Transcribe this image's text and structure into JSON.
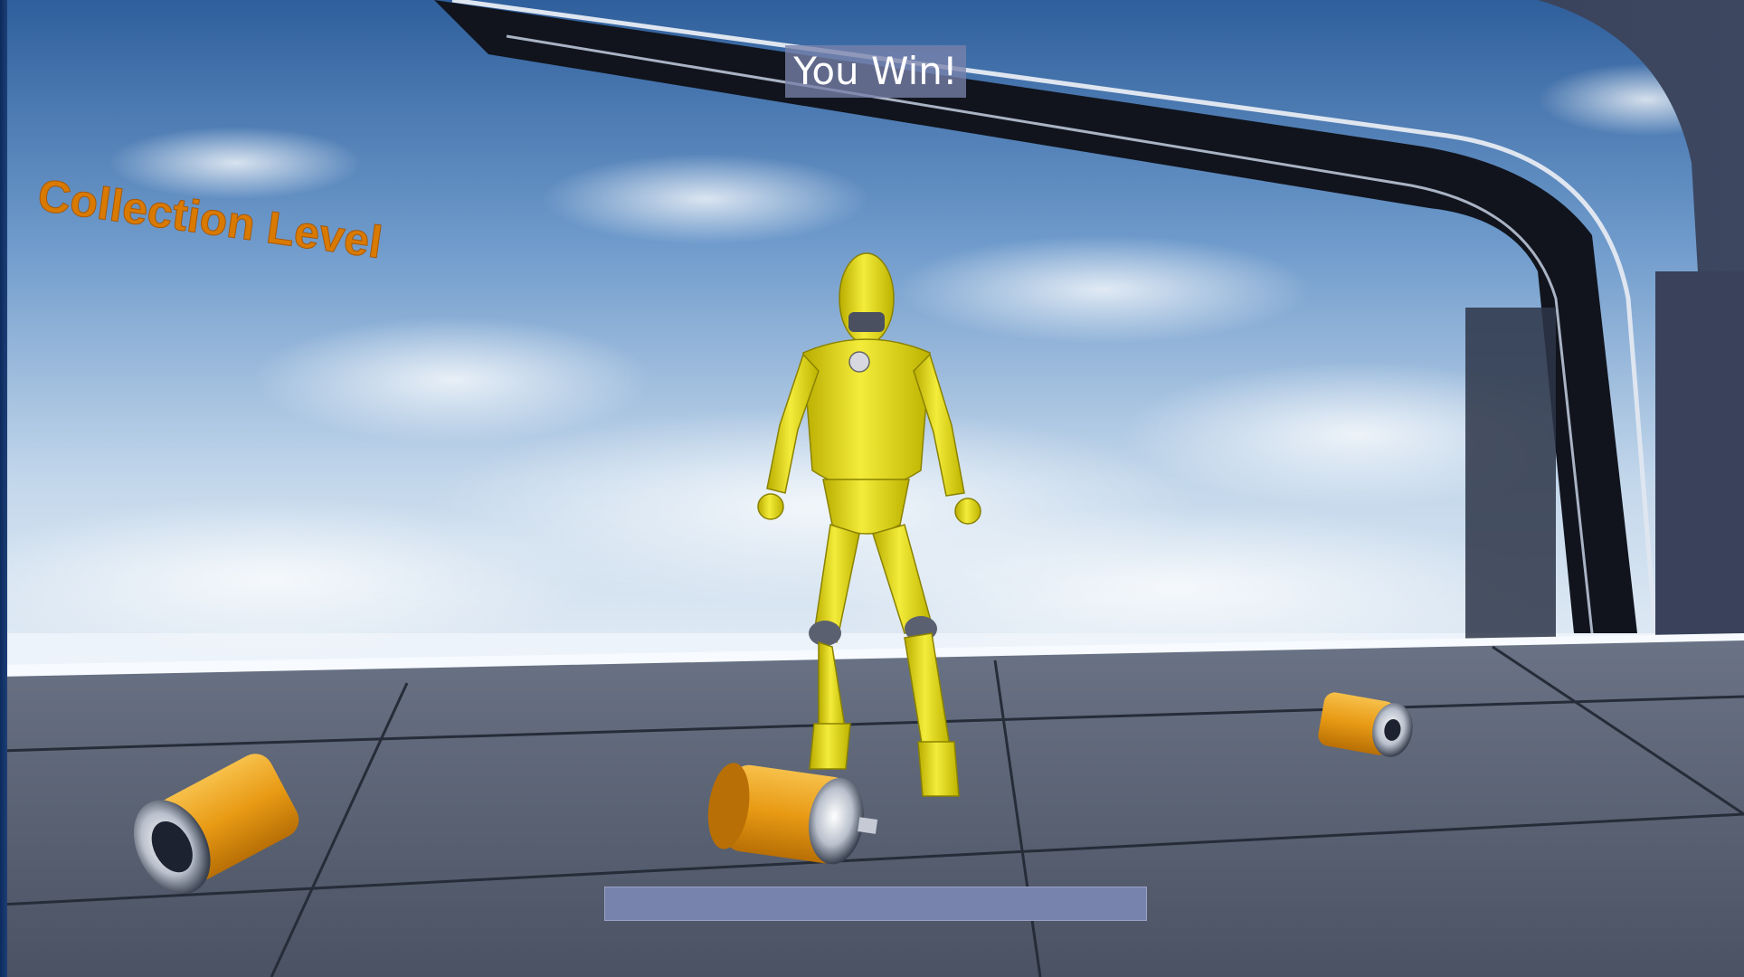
{
  "hud": {
    "win_message": "You Win!",
    "progress": 1.0
  },
  "world": {
    "level_sign": "Collection Level",
    "level_sign_color": "#d97a00",
    "character_color": "#e6dc14",
    "battery_color": "#f0a423"
  }
}
